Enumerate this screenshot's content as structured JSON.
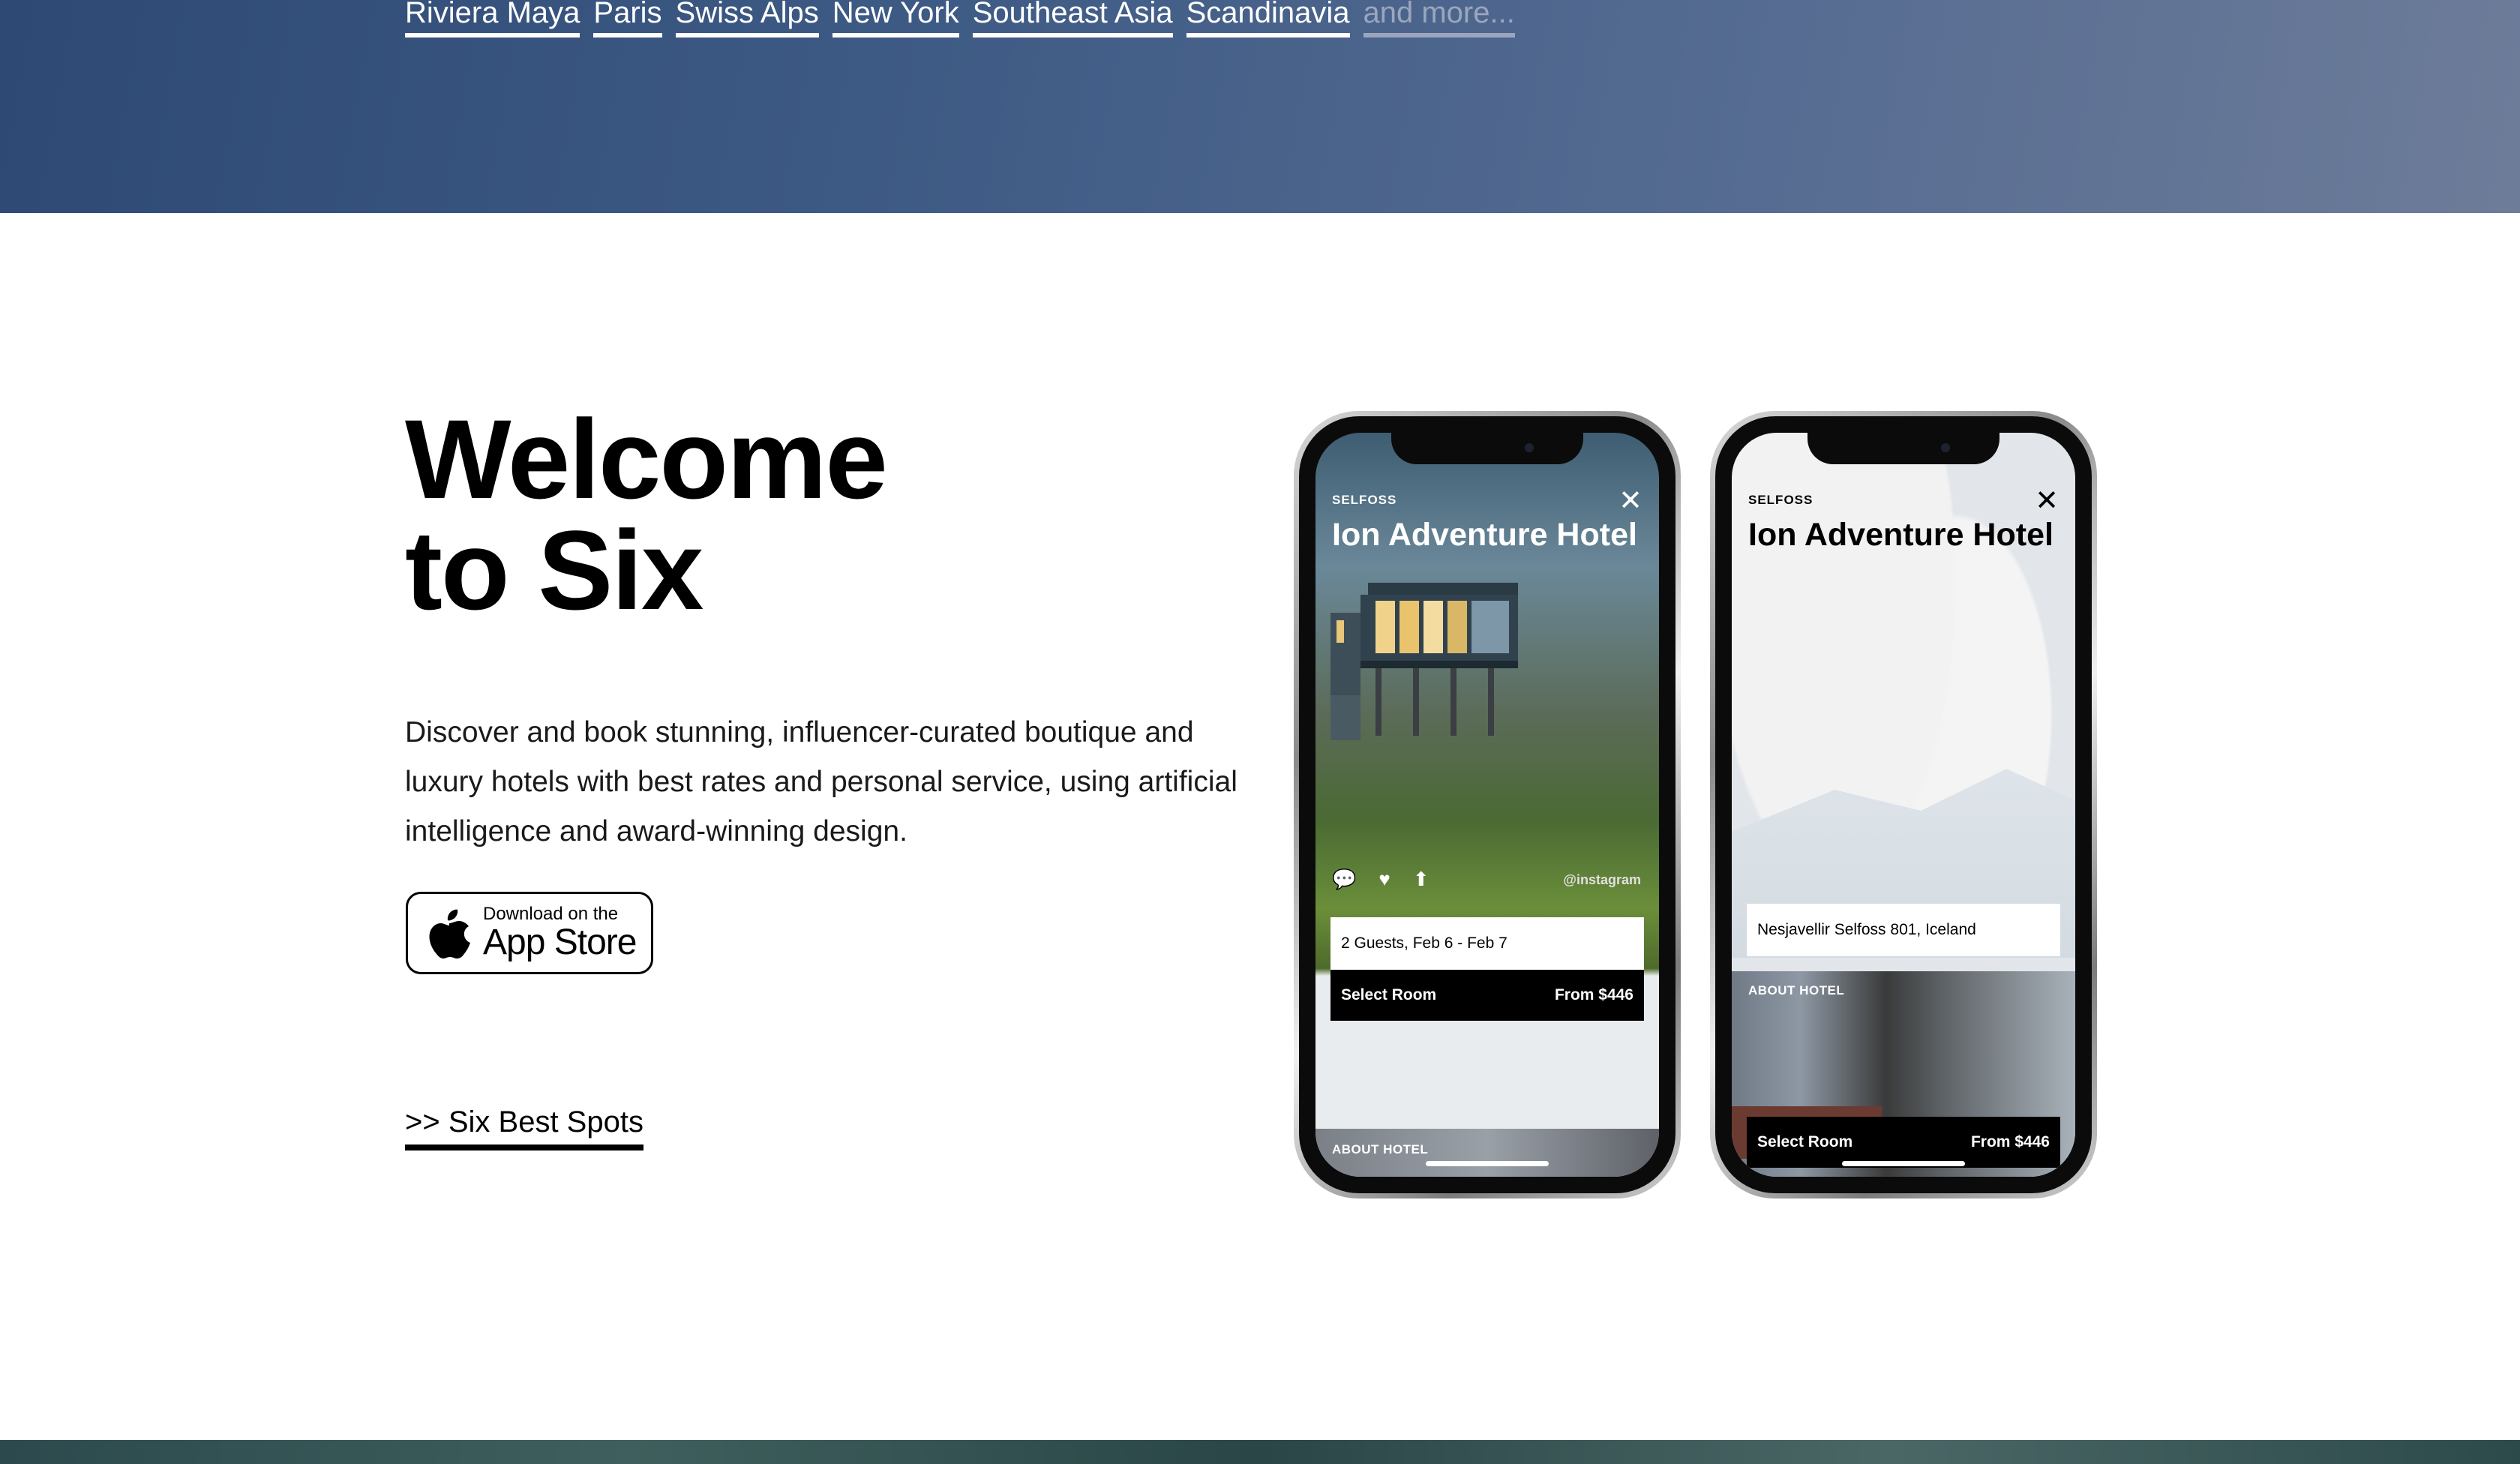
{
  "destinations": {
    "items": [
      "Riviera Maya",
      "Paris",
      "Swiss Alps",
      "New York",
      "Southeast Asia",
      "Scandinavia"
    ],
    "more_label": "and more..."
  },
  "welcome": {
    "title_line1": "Welcome",
    "title_line2": "to Six",
    "description": "Discover and book stunning, influencer-curated boutique and luxury hotels with best rates and personal service, using artificial intelligence and award-winning design."
  },
  "app_store": {
    "small_label": "Download on the",
    "big_label": "App Store"
  },
  "best_spots_link": ">> Six Best Spots",
  "phone_one": {
    "city": "SELFOSS",
    "close_glyph": "✕",
    "hotel_name": "Ion Adventure Hotel",
    "guests": "2 Guests, Feb 6 - Feb 7",
    "select_label": "Select Room",
    "price": "From $446",
    "about_label": "ABOUT HOTEL",
    "photo_credit": "@instagram"
  },
  "phone_two": {
    "city": "SELFOSS",
    "close_glyph": "✕",
    "hotel_name": "Ion Adventure Hotel",
    "address": "Nesjavellir Selfoss 801,  Iceland",
    "about_label": "ABOUT HOTEL",
    "select_label": "Select Room",
    "price": "From $446"
  },
  "icons": [
    "apple-icon",
    "chat-icon",
    "heart-icon",
    "share-icon",
    "close-icon"
  ]
}
